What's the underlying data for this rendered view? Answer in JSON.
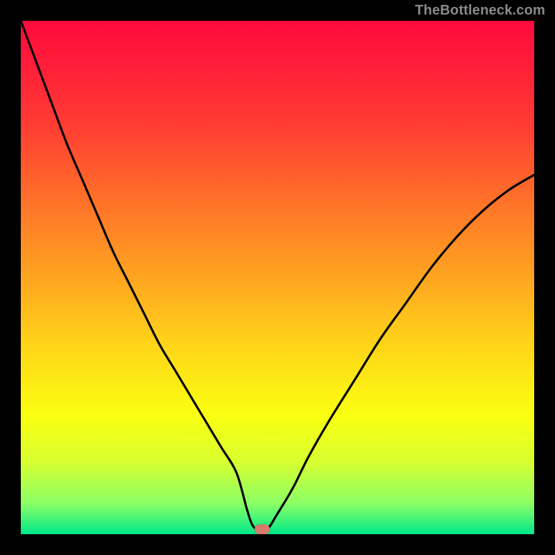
{
  "watermark": "TheBottleneck.com",
  "colors": {
    "watermark_text": "#8a8a8a",
    "frame_bg": "#000000",
    "curve_stroke": "#000000",
    "marker_fill": "#d97a6a",
    "gradient_top": "#ff0a3c",
    "gradient_bottom": "#00e88a"
  },
  "chart_data": {
    "type": "line",
    "title": "",
    "xlabel": "",
    "ylabel": "",
    "xlim": [
      0,
      100
    ],
    "ylim": [
      0,
      100
    ],
    "grid": false,
    "series": [
      {
        "name": "bottleneck-curve",
        "x": [
          0,
          3,
          6,
          9,
          12,
          15,
          18,
          21,
          24,
          27,
          30,
          33,
          36,
          39,
          42,
          44,
          45,
          46,
          48,
          50,
          53,
          56,
          60,
          65,
          70,
          75,
          80,
          85,
          90,
          95,
          100
        ],
        "y": [
          100,
          92,
          84,
          76,
          69,
          62,
          55,
          49,
          43,
          37,
          32,
          27,
          22,
          17,
          12,
          5,
          2,
          1,
          1,
          4,
          9,
          15,
          22,
          30,
          38,
          45,
          52,
          58,
          63,
          67,
          70
        ]
      }
    ],
    "marker": {
      "x": 47,
      "y": 1
    }
  }
}
